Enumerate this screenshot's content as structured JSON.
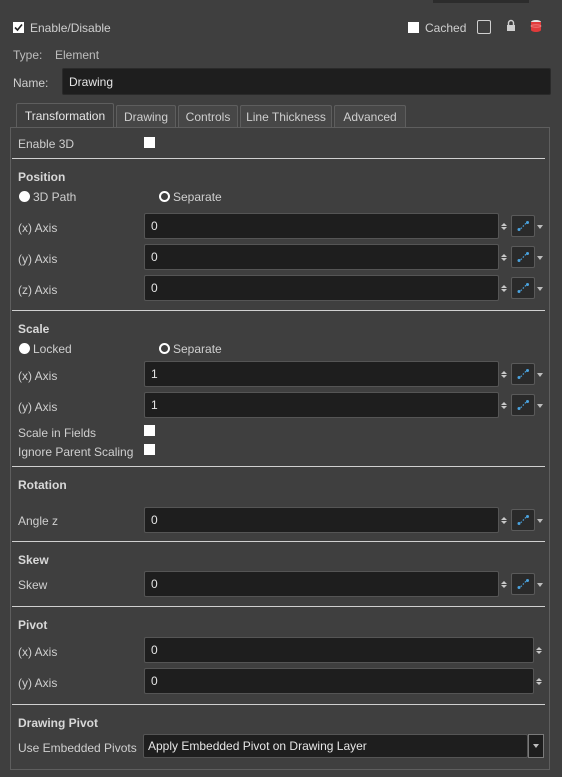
{
  "header": {
    "enable_label": "Enable/Disable",
    "enable_checked": true,
    "cached_label": "Cached",
    "type_label": "Type:",
    "type_value": "Element",
    "name_label": "Name:",
    "name_value": "Drawing"
  },
  "tabs": [
    "Transformation",
    "Drawing",
    "Controls",
    "Line Thickness",
    "Advanced"
  ],
  "active_tab": "Transformation",
  "enable3d": {
    "label": "Enable 3D",
    "checked": false
  },
  "position": {
    "title": "Position",
    "mode_3d_path": "3D Path",
    "mode_separate": "Separate",
    "x_label": "(x) Axis",
    "x_value": "0",
    "y_label": "(y) Axis",
    "y_value": "0",
    "z_label": "(z) Axis",
    "z_value": "0"
  },
  "scale": {
    "title": "Scale",
    "mode_locked": "Locked",
    "mode_separate": "Separate",
    "x_label": "(x) Axis",
    "x_value": "1",
    "y_label": "(y) Axis",
    "y_value": "1",
    "scale_in_fields": "Scale in Fields",
    "ignore_parent": "Ignore Parent Scaling"
  },
  "rotation": {
    "title": "Rotation",
    "angle_label": "Angle z",
    "angle_value": "0"
  },
  "skew": {
    "title": "Skew",
    "label": "Skew",
    "value": "0"
  },
  "pivot": {
    "title": "Pivot",
    "x_label": "(x) Axis",
    "x_value": "0",
    "y_label": "(y) Axis",
    "y_value": "0"
  },
  "drawing_pivot": {
    "title": "Drawing Pivot",
    "label": "Use Embedded Pivots",
    "value": "Apply Embedded Pivot on Drawing Layer"
  },
  "colors": {
    "background": "#3f3f3f",
    "field": "#1e1e1e",
    "accent": "#4aa3df",
    "db_icon": "#e03a3a"
  }
}
